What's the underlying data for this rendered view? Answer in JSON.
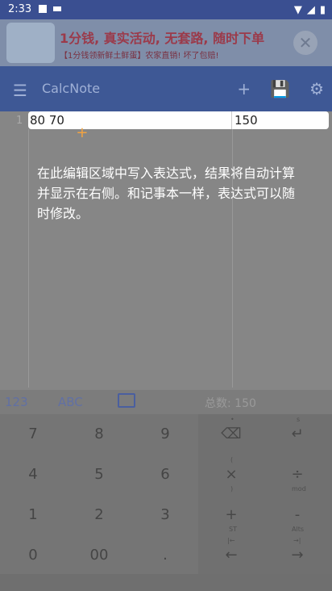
{
  "status": {
    "time": "2:33"
  },
  "ad": {
    "title": "1分钱, 真实活动, 无套路, 随时下单",
    "subtitle": "【1分钱领新鲜土鲜蛋】农家直销! 坏了包赔!",
    "close_label": "✕"
  },
  "toolbar": {
    "title": "CalcNote",
    "menu_icon": "☰",
    "add_icon": "+",
    "save_icon": "💾",
    "settings_icon": "⚙"
  },
  "editor": {
    "line_number": "1",
    "expression": {
      "left": "80",
      "operator": "+",
      "right": "70"
    },
    "result": "150",
    "tip": "在此编辑区域中写入表达式，结果将自动计算并显示在右侧。和记事本一样，表达式可以随时修改。"
  },
  "keyboard_tabs": {
    "tab_123": "123",
    "tab_abc": "ABC",
    "total": "总数: 150"
  },
  "keys": {
    "digits": [
      "7",
      "8",
      "9",
      "4",
      "5",
      "6",
      "1",
      "2",
      "3",
      "0",
      "00",
      "."
    ],
    "ops": {
      "backspace": "⌫",
      "enter": "↵",
      "multiply": "×",
      "divide": "÷",
      "plus": "+",
      "minus": "-",
      "left": "←",
      "right": "→"
    },
    "ops_sub": {
      "backspace_top": "•",
      "enter_top": "s",
      "multiply_top": "(",
      "multiply_bottom": ")",
      "divide_bottom": "mod",
      "plus_bottom": "ST",
      "minus_bottom": "Alts",
      "left_top": "|←",
      "right_top": "→|"
    }
  }
}
